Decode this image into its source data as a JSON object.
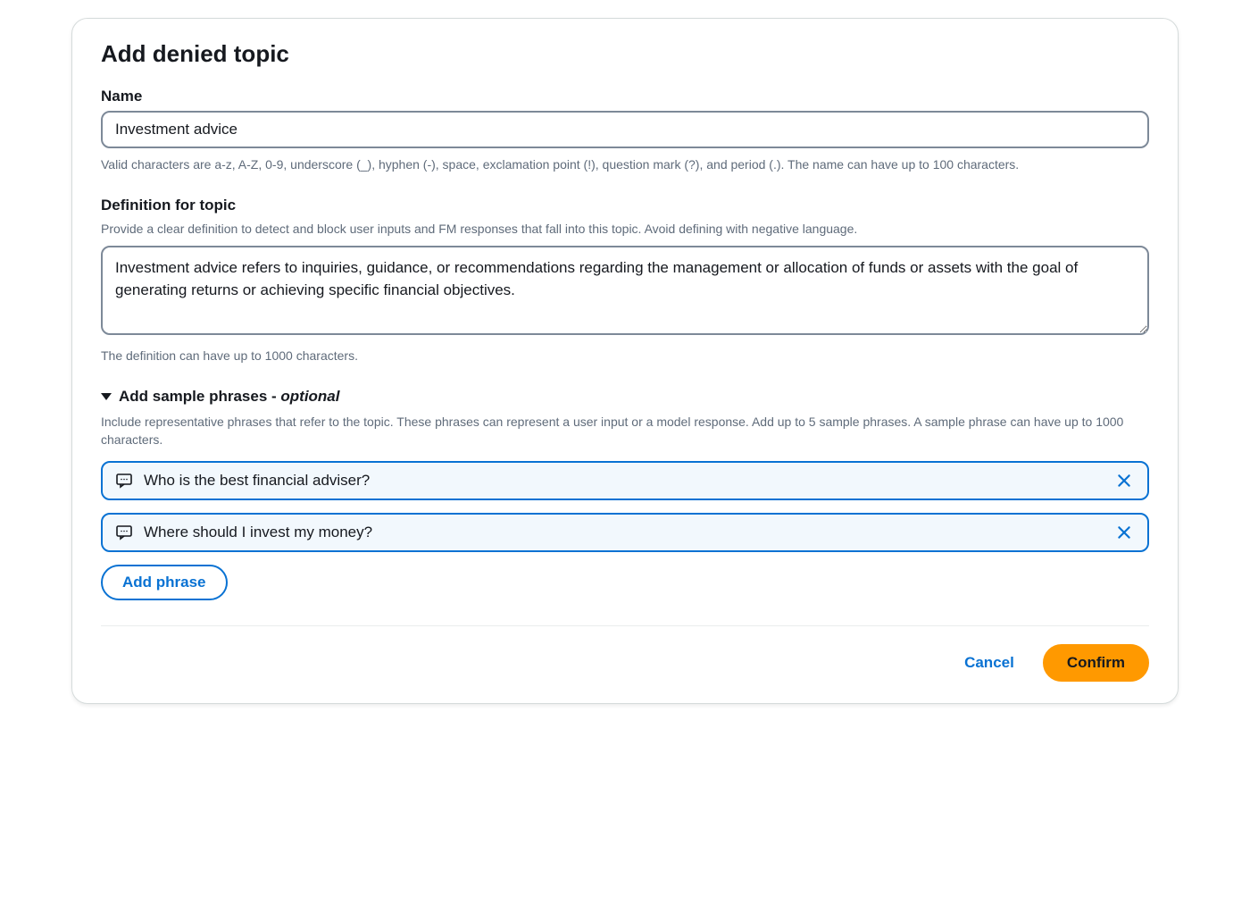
{
  "modal": {
    "title": "Add denied topic",
    "name_field": {
      "label": "Name",
      "value": "Investment advice",
      "helper": "Valid characters are a-z, A-Z, 0-9, underscore (_), hyphen (-), space, exclamation point (!), question mark (?), and period (.). The name can have up to 100 characters."
    },
    "definition_field": {
      "label": "Definition for topic",
      "sublabel": "Provide a clear definition to detect and block user inputs and FM responses that fall into this topic. Avoid defining with negative language.",
      "value": "Investment advice refers to inquiries, guidance, or recommendations regarding the management or allocation of funds or assets with the goal of generating returns or achieving specific financial objectives.",
      "helper": "The definition can have up to 1000 characters."
    },
    "sample_phrases": {
      "title_prefix": "Add sample phrases - ",
      "title_optional": "optional",
      "helper": "Include representative phrases that refer to the topic. These phrases can represent a user input or a model response. Add up to 5 sample phrases. A sample phrase can have up to 1000 characters.",
      "items": [
        {
          "text": "Who is the best financial adviser?"
        },
        {
          "text": "Where should I invest my money?"
        }
      ],
      "add_button": "Add phrase"
    },
    "footer": {
      "cancel": "Cancel",
      "confirm": "Confirm"
    }
  }
}
